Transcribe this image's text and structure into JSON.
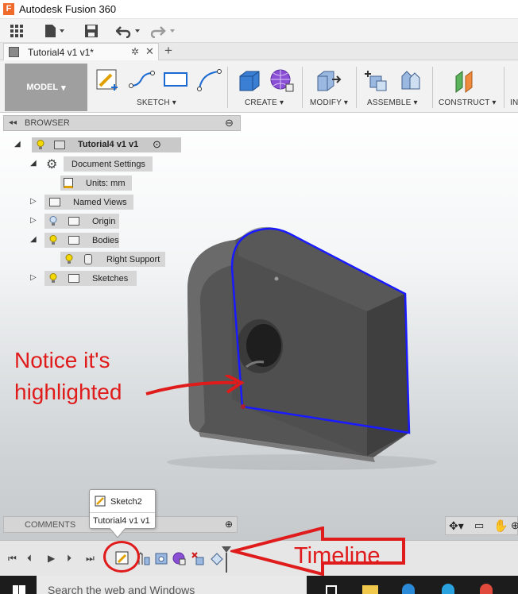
{
  "window": {
    "title": "Autodesk Fusion 360",
    "logo": "F"
  },
  "quick_access": {
    "icons": [
      "grid-icon",
      "file-icon",
      "save-icon",
      "undo-icon",
      "redo-icon"
    ]
  },
  "document_tab": {
    "label": "Tutorial4 v1 v1*",
    "add_tab": "+"
  },
  "toolbar": {
    "workspace": "MODEL",
    "groups": [
      {
        "label": "SKETCH"
      },
      {
        "label": "CREATE"
      },
      {
        "label": "MODIFY"
      },
      {
        "label": "ASSEMBLE"
      },
      {
        "label": "CONSTRUCT"
      }
    ],
    "overflow_label": "IN"
  },
  "browser": {
    "header": "BROWSER",
    "root": "Tutorial4 v1 v1",
    "items": [
      {
        "label": "Document Settings"
      },
      {
        "label": "Units: mm"
      },
      {
        "label": "Named Views"
      },
      {
        "label": "Origin"
      },
      {
        "label": "Bodies"
      },
      {
        "label": "Right Support"
      },
      {
        "label": "Sketches"
      }
    ]
  },
  "comments": {
    "label": "COMMENTS"
  },
  "tooltip": {
    "name": "Sketch2",
    "document": "Tutorial4 v1 v1"
  },
  "taskbar": {
    "search_placeholder": "Search the web and Windows"
  },
  "annotations": {
    "notice_line1": "Notice it's",
    "notice_line2": "highlighted",
    "timeline": "Timeline",
    "color": "#e01b1b"
  },
  "colors": {
    "highlight_edge": "#1a1aff",
    "part_body": "#5c5c5c"
  }
}
